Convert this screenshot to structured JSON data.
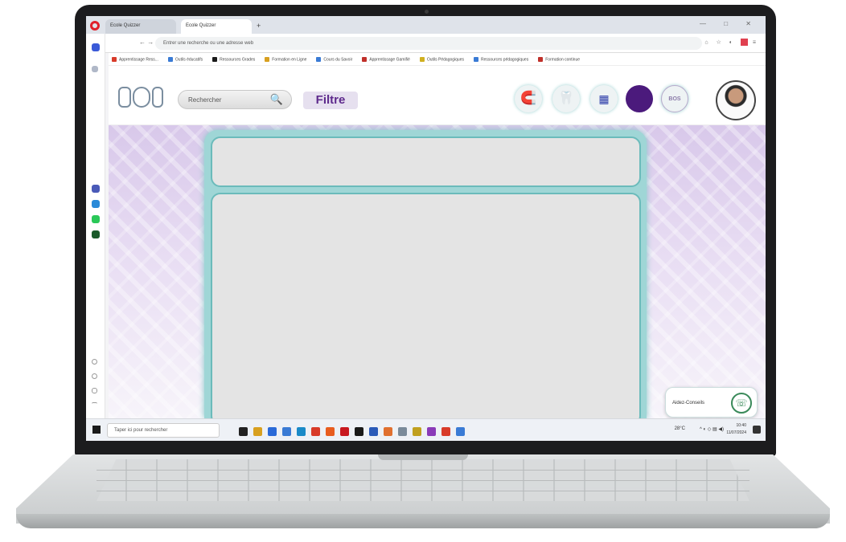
{
  "browser": {
    "tabs": [
      {
        "label": "Ecole Quizzer"
      },
      {
        "label": "Ecole Quizzer"
      }
    ],
    "new_tab": "+",
    "window_controls": "—  □  ✕",
    "nav_icons": "← →  C",
    "url": "Entrer une recherche ou une adresse web",
    "bookmarks": [
      {
        "label": "Apprentissage Ress...",
        "color": "#d83b2a"
      },
      {
        "label": "Outils éducatifs",
        "color": "#3a7bd5"
      },
      {
        "label": "Ressources Grades",
        "color": "#1a1a1a"
      },
      {
        "label": "Formation en Ligne",
        "color": "#d8a020"
      },
      {
        "label": "Cours du Savoir",
        "color": "#3a7bd5"
      },
      {
        "label": "Apprentissage Gamifié",
        "color": "#c0302a"
      },
      {
        "label": "Outils Pédagogiques",
        "color": "#d0b020"
      },
      {
        "label": "Ressources pédagogiques",
        "color": "#3a7bd5"
      },
      {
        "label": "Formation continue",
        "color": "#c0302a"
      }
    ]
  },
  "header": {
    "search_placeholder": "Rechercher",
    "search_icon": "🔍",
    "filter_label": "Filtre",
    "icons": [
      {
        "name": "magnet-icon",
        "glyph": "🧲",
        "color": "#4b3a8c"
      },
      {
        "name": "tooth-icon",
        "glyph": "🦷",
        "color": "#4b3a8c"
      },
      {
        "name": "board-icon",
        "glyph": "▦",
        "color": "#2a3aa8"
      },
      {
        "name": "dark-circle-icon",
        "glyph": "",
        "color": "#4b1a7c"
      },
      {
        "name": "bos-plus-icon",
        "glyph": "BOS",
        "color": "#8a7aa8"
      }
    ]
  },
  "chat_widget": {
    "label": "Aidez-Conseils",
    "icon": "☏"
  },
  "taskbar": {
    "search_placeholder": "Taper ici pour rechercher",
    "weather": "28°C",
    "time": "10:40",
    "date": "11/07/2024",
    "apps": [
      "#222",
      "#d8a020",
      "#2a6ad8",
      "#3a7bd5",
      "#1a8ac8",
      "#d83b2a",
      "#e85d20",
      "#c81820",
      "#1a1a1a",
      "#2a5ab8",
      "#e07030",
      "#7a8a9a",
      "#c0a020",
      "#8a3ab8",
      "#d83b2a",
      "#3a7bd5"
    ]
  },
  "colors": {
    "accent": "#5e2a8c",
    "panel": "#9fd6d6",
    "card": "#e4e4e4"
  }
}
